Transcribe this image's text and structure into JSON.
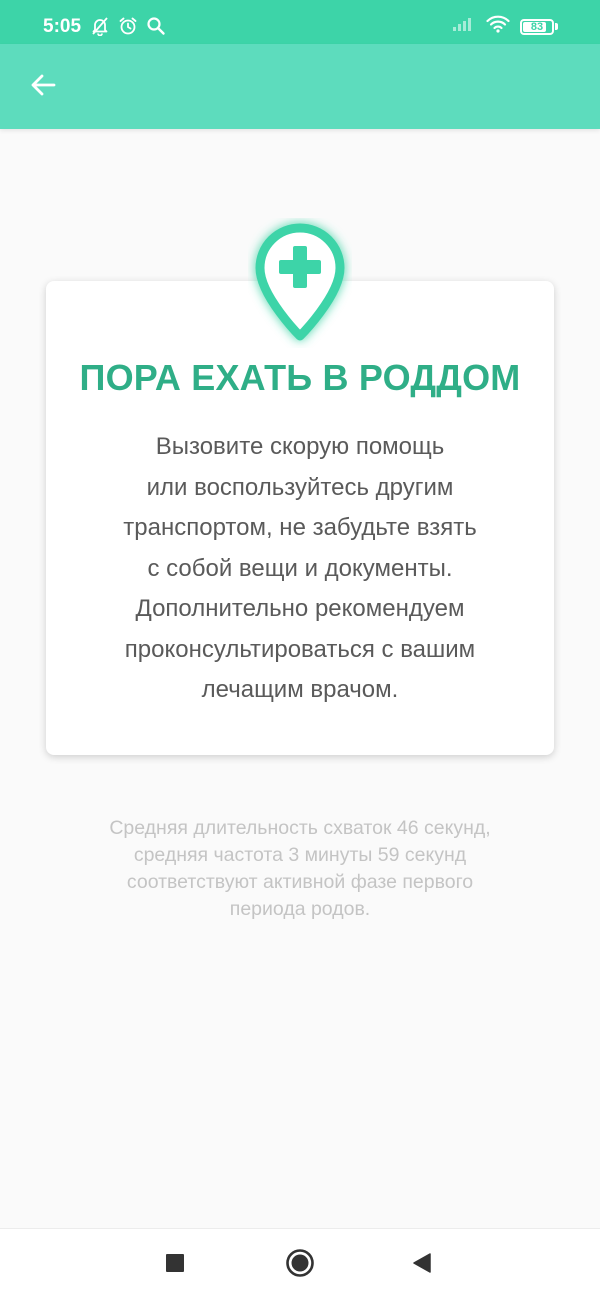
{
  "status_bar": {
    "time": "5:05",
    "battery": "83",
    "battery_level": 0.83,
    "icons": [
      "notifications-off-icon",
      "alarm-icon",
      "search-icon",
      "signal-icon",
      "wifi-icon",
      "battery-icon"
    ]
  },
  "app_bar": {
    "back_icon": "arrow-left-icon"
  },
  "card": {
    "icon": "medical-pin-icon",
    "title": "ПОРА ЕХАТЬ В РОДДОМ",
    "body_lines": [
      "Вызовите скорую помощь",
      "или воспользуйтесь другим",
      "транспортом, не забудьте взять",
      "с собой вещи и документы.",
      "Дополнительно рекомендуем",
      "проконсультироваться с вашим",
      "лечащим врачом."
    ]
  },
  "footnote_lines": [
    "Средняя длительность схваток 46 секунд,",
    "средняя частота 3 минуты 59 секунд",
    "соответствуют активной фазе первого",
    "периода родов."
  ],
  "nav_bar": {
    "icons": [
      "recents-square-icon",
      "home-circle-icon",
      "back-triangle-icon"
    ]
  },
  "colors": {
    "status_bar": "#3dd4a8",
    "app_bar": "#5ddcbd",
    "accent": "#2fae87",
    "pin": "#3dd4a8"
  }
}
